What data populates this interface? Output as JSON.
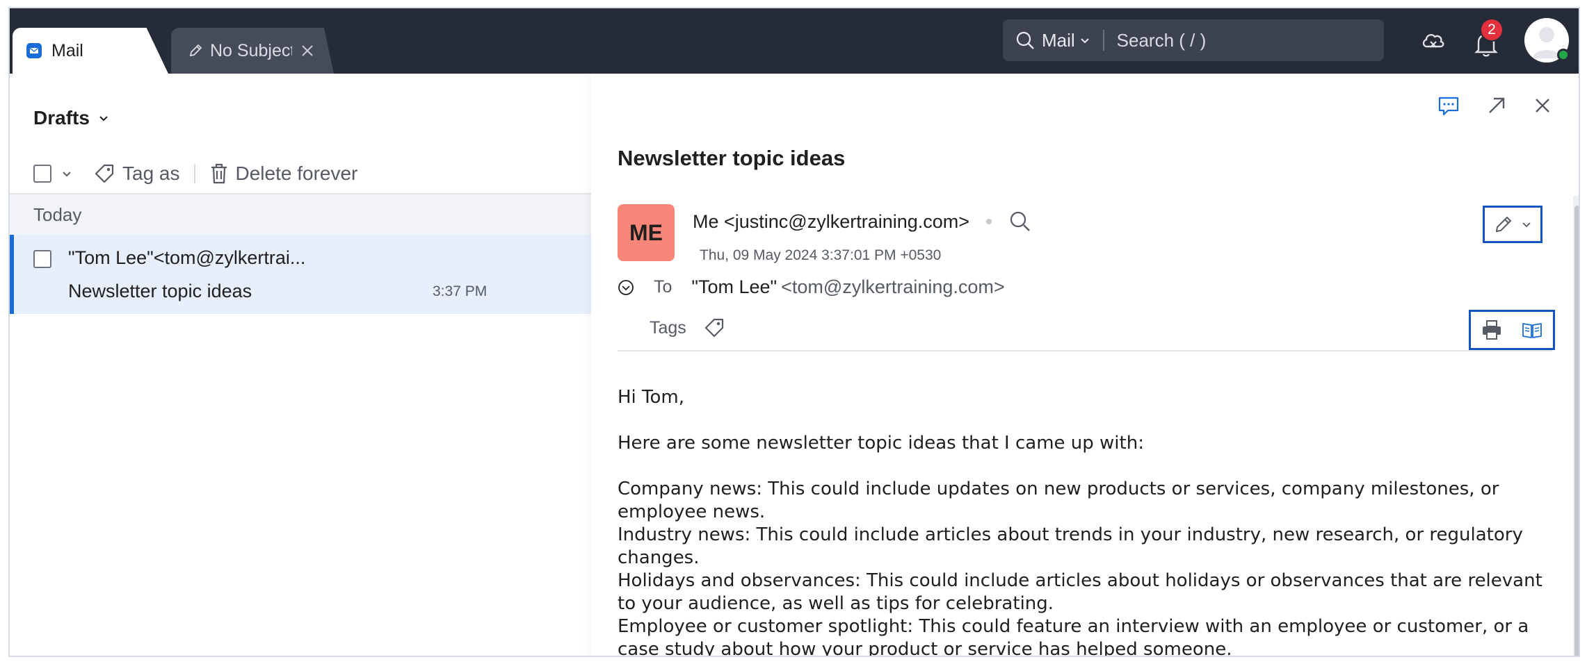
{
  "tabs": {
    "mail_label": "Mail",
    "draft_label": "No Subject"
  },
  "search": {
    "scope": "Mail",
    "placeholder": "Search ( / )"
  },
  "notifications": {
    "count": "2"
  },
  "folder": {
    "title": "Drafts"
  },
  "toolbar": {
    "tag_label": "Tag as",
    "delete_label": "Delete forever"
  },
  "list": {
    "group": "Today",
    "items": [
      {
        "from": "\"Tom Lee\"<tom@zylkertrai...",
        "subject": "Newsletter topic ideas",
        "time": "3:37 PM"
      }
    ]
  },
  "message": {
    "subject": "Newsletter topic ideas",
    "avatar_initials": "ME",
    "sender": "Me <justinc@zylkertraining.com>",
    "date": "Thu, 09 May 2024 3:37:01 PM +0530",
    "to_label": "To",
    "to_name": "\"Tom Lee\"",
    "to_address": "<tom@zylkertraining.com>",
    "tags_label": "Tags",
    "body": {
      "greeting": "Hi Tom,",
      "intro": "Here are some newsletter topic ideas that I came up with:",
      "points": [
        "Company news: This could include updates on new products or services, company milestones, or employee news.",
        "Industry news: This could include articles about trends in your industry, new research, or regulatory changes.",
        "Holidays and observances: This could include articles about holidays or observances that are relevant to your audience, as well as tips for celebrating.",
        "Employee or customer spotlight: This could feature an interview with an employee or customer, or a case study about how your product or service has helped someone."
      ]
    }
  },
  "colors": {
    "topbar": "#262b38",
    "accent": "#1a6cd8",
    "highlight_box": "#1454c0",
    "avatar_bg": "#f8877a",
    "selected_row": "#e7effc",
    "badge": "#e2313c"
  }
}
